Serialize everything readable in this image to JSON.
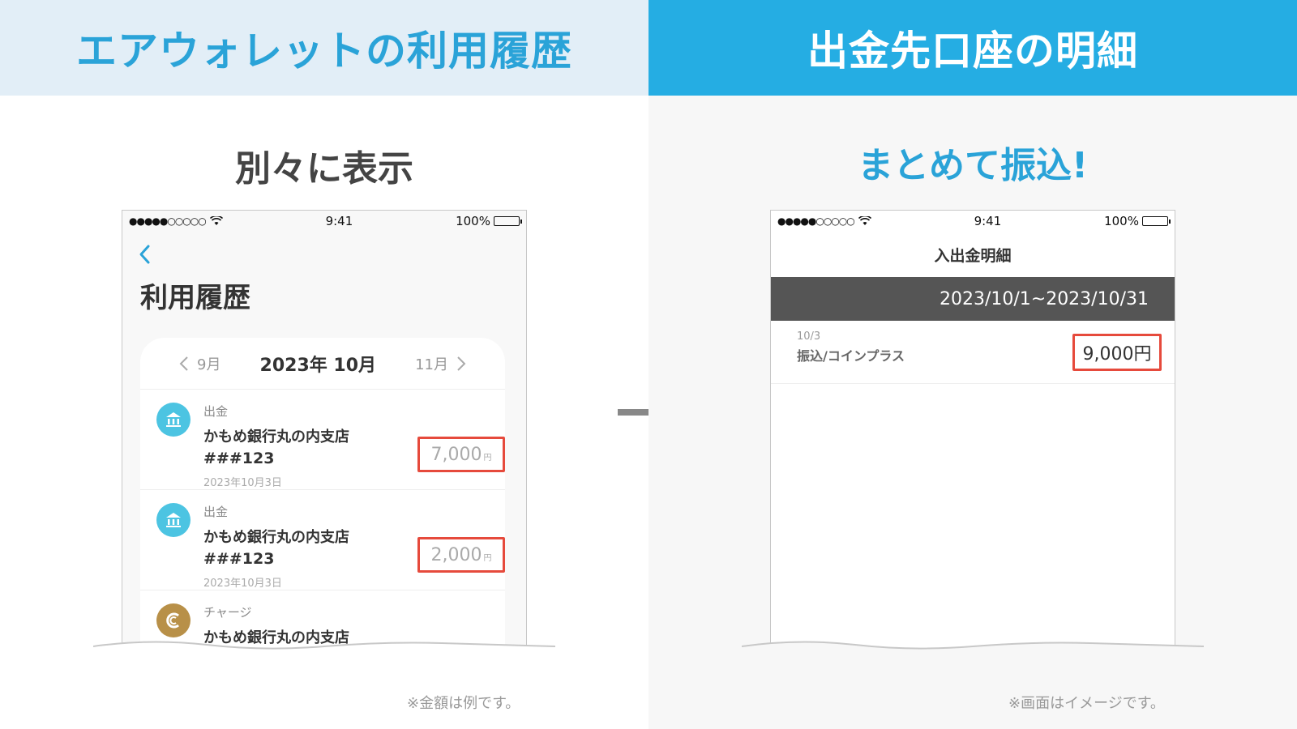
{
  "left": {
    "banner": "エアウォレットの利用履歴",
    "subtitle": "別々に表示",
    "phone": {
      "signal": "●●●●●○○○○○",
      "time": "9:41",
      "battery": "100%",
      "title": "利用履歴",
      "month_nav": {
        "prev": "9月",
        "current": "2023年 10月",
        "next": "11月"
      },
      "transactions": [
        {
          "type": "出金",
          "name": "かもめ銀行丸の内支店",
          "account": "###123",
          "date": "2023年10月3日",
          "amount": "7,000",
          "unit": "円",
          "icon": "bank-icon"
        },
        {
          "type": "出金",
          "name": "かもめ銀行丸の内支店",
          "account": "###123",
          "date": "2023年10月3日",
          "amount": "2,000",
          "unit": "円",
          "icon": "bank-icon"
        },
        {
          "type": "チャージ",
          "name": "かもめ銀行丸の内支店",
          "icon": "coin-icon"
        }
      ]
    },
    "note": "※金額は例です。"
  },
  "right": {
    "banner": "出金先口座の明細",
    "subtitle": "まとめて振込!",
    "phone": {
      "signal": "●●●●●○○○○○",
      "time": "9:41",
      "battery": "100%",
      "title": "入出金明細",
      "period": "2023/10/1~2023/10/31",
      "rows": [
        {
          "date": "10/3",
          "desc": "振込/コインプラス",
          "amount": "9,000円"
        }
      ]
    },
    "note": "※画面はイメージです。"
  },
  "colors": {
    "accent_blue": "#25ade3",
    "highlight_red": "#e64a3c",
    "bank_icon": "#4cc4e2",
    "coin_icon": "#b89048"
  }
}
